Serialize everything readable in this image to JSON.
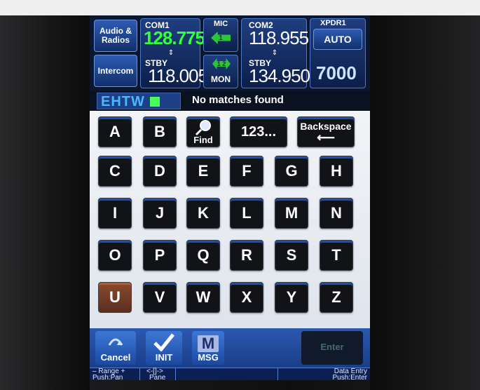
{
  "radio": {
    "audio_radios_label": "Audio & Radios",
    "intercom_label": "Intercom",
    "com1": {
      "label": "COM1",
      "active": "128.775",
      "stby_label": "STBY",
      "standby": "118.005"
    },
    "mic_label": "MIC",
    "mic_num": "1",
    "mon_label": "MON",
    "mon_num": "1 2",
    "com2": {
      "label": "COM2",
      "active": "118.955",
      "stby_label": "STBY",
      "standby": "134.950"
    },
    "xpdr": {
      "label": "XPDR1",
      "mode": "AUTO",
      "code": "7000"
    }
  },
  "scratchpad": {
    "entry": "EHTW",
    "message": "No matches found"
  },
  "keys": {
    "row1": [
      "A",
      "B"
    ],
    "find_label": "Find",
    "numeric_label": "123...",
    "backspace_label": "Backspace",
    "row2": [
      "C",
      "D",
      "E",
      "F",
      "G",
      "H"
    ],
    "row3": [
      "I",
      "J",
      "K",
      "L",
      "M",
      "N"
    ],
    "row4": [
      "O",
      "P",
      "Q",
      "R",
      "S",
      "T"
    ],
    "row5": [
      "U",
      "V",
      "W",
      "X",
      "Y",
      "Z"
    ]
  },
  "softkeys": {
    "cancel": "Cancel",
    "init": "INIT",
    "msg_icon": "M",
    "msg": "MSG",
    "enter": "Enter"
  },
  "status": {
    "range": "– Range +",
    "pan": "Push:Pan",
    "pane_icon": "<‑[]‑>",
    "pane": "Pane",
    "data_entry": "Data Entry",
    "push_enter": "Push:Enter"
  },
  "colors": {
    "active_freq": "#33ff3a",
    "entry_text": "#49b8ff",
    "cursor": "#46ff57",
    "panel_blue": "#2d5bb3"
  }
}
